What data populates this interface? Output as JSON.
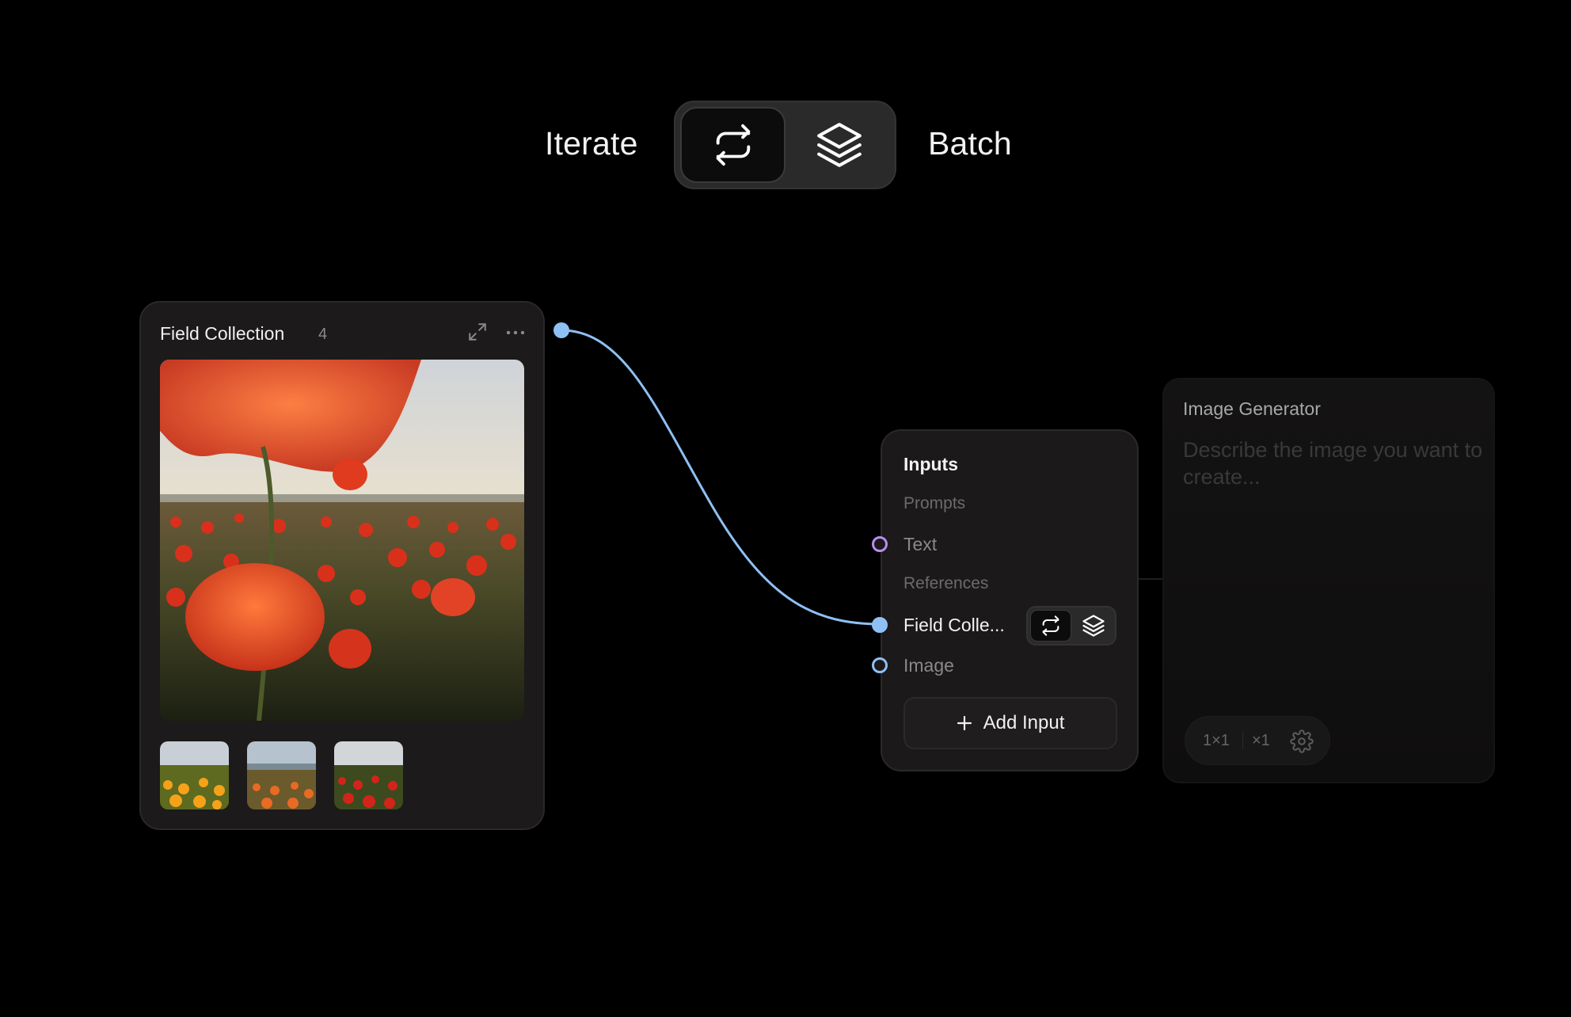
{
  "toggle": {
    "left_label": "Iterate",
    "right_label": "Batch",
    "active": "iterate"
  },
  "collection": {
    "title": "Field Collection",
    "count": "4",
    "icons": [
      "expand-icon",
      "more-icon"
    ]
  },
  "inputs": {
    "title": "Inputs",
    "prompts_label": "Prompts",
    "text_label": "Text",
    "references_label": "References",
    "field_label": "Field Colle...",
    "image_label": "Image",
    "add_input_label": "Add Input"
  },
  "generator": {
    "title": "Image Generator",
    "placeholder": "Describe the image you want to create...",
    "aspect": "1×1",
    "count": "×1"
  },
  "colors": {
    "link": "#8ec0f5",
    "text_port": "#b98cf0",
    "image_port": "#8ec0f5"
  }
}
